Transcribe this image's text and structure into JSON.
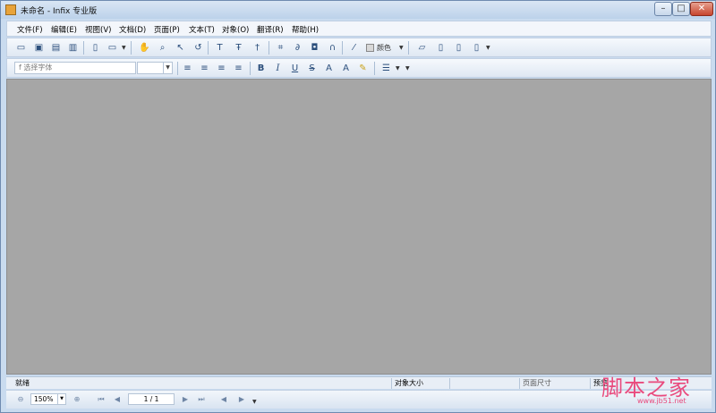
{
  "window": {
    "title": "未命名 - Infix 专业版",
    "controls": {
      "minimize": "–",
      "maximize": "□",
      "close": "✕"
    }
  },
  "menubar": {
    "items": [
      "文件(F)",
      "编辑(E)",
      "视图(V)",
      "文档(D)",
      "页面(P)",
      "文本(T)",
      "对象(O)",
      "翻译(R)",
      "帮助(H)"
    ]
  },
  "toolbar1": {
    "color_label": "颜色",
    "icons": [
      "open-icon",
      "save-icon",
      "save-as-icon",
      "print-icon",
      "export-icon",
      "import-icon",
      "hand-icon",
      "zoom-icon",
      "pointer-icon",
      "undo-icon",
      "text-tool-icon",
      "text-edit-icon",
      "text-flow-icon",
      "crop-icon",
      "link-icon",
      "camera-icon",
      "path-icon",
      "eyedropper-icon",
      "comment-icon",
      "page-add-icon",
      "page-import-icon",
      "page-delete-icon"
    ]
  },
  "toolbar2": {
    "font_placeholder": "选择字体",
    "font_icon_glyph": "f",
    "bold": "B",
    "italic": "I",
    "underline": "U",
    "strike": "S",
    "superscript": "A",
    "subscript": "A"
  },
  "statusbar": {
    "status": "就绪",
    "object_size": "对象大小",
    "page_size": "页面尺寸",
    "preview": "预览"
  },
  "navbar": {
    "zoom": "150%",
    "page": "1 / 1"
  },
  "watermark": {
    "text": "脚本之家",
    "url": "www.jb51.net"
  },
  "colors": {
    "canvas": "#a6a6a6",
    "chrome": "#c9dbef",
    "watermark": "#e94a7d"
  }
}
